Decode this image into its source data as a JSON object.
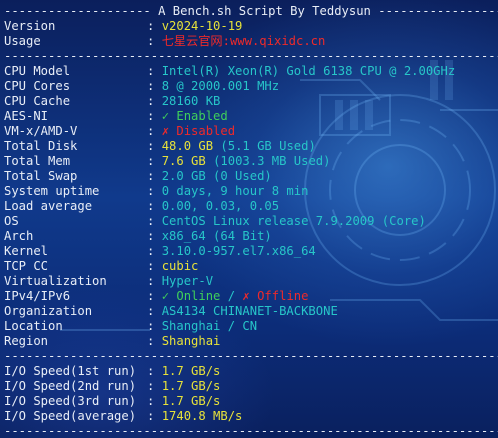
{
  "header_title": "A Bench.sh Script By Teddysun",
  "dash_left": "--------------------",
  "dash_right": "-------------------",
  "separator": "----------------------------------------------------------------------",
  "colon": ":",
  "meta": [
    {
      "label": "Version",
      "value": "v2024-10-19",
      "color": "yellow"
    },
    {
      "label": "Usage",
      "value": "七星云官网:www.qixidc.cn",
      "color": "red"
    }
  ],
  "system": [
    {
      "label": "CPU Model",
      "value": "Intel(R) Xeon(R) Gold 6138 CPU @ 2.00GHz",
      "color": "cyan"
    },
    {
      "label": "CPU Cores",
      "value": "8 @ 2000.001 MHz",
      "color": "cyan"
    },
    {
      "label": "CPU Cache",
      "value": "28160 KB",
      "color": "cyan"
    },
    {
      "label": "AES-NI",
      "value": "✓ Enabled",
      "color": "green"
    },
    {
      "label": "VM-x/AMD-V",
      "value": "✗ Disabled",
      "color": "red"
    },
    {
      "label": "Total Disk",
      "value": "48.0 GB",
      "color": "yellow",
      "extra": "(5.1 GB Used)"
    },
    {
      "label": "Total Mem",
      "value": "7.6 GB",
      "color": "yellow",
      "extra": "(1003.3 MB Used)"
    },
    {
      "label": "Total Swap",
      "value": "2.0 GB (0 Used)",
      "color": "cyan"
    },
    {
      "label": "System uptime",
      "value": "0 days, 9 hour 8 min",
      "color": "cyan"
    },
    {
      "label": "Load average",
      "value": "0.00, 0.03, 0.05",
      "color": "cyan"
    },
    {
      "label": "OS",
      "value": "CentOS Linux release 7.9.2009 (Core)",
      "color": "cyan"
    },
    {
      "label": "Arch",
      "value": "x86_64 (64 Bit)",
      "color": "cyan"
    },
    {
      "label": "Kernel",
      "value": "3.10.0-957.el7.x86_64",
      "color": "cyan"
    },
    {
      "label": "TCP CC",
      "value": "cubic",
      "color": "yellow"
    },
    {
      "label": "Virtualization",
      "value": "Hyper-V",
      "color": "cyan"
    },
    {
      "label": "IPv4/IPv6",
      "value": "✓ Online",
      "color": "green",
      "sep": "/",
      "value2": "✗ Offline",
      "color2": "red"
    },
    {
      "label": "Organization",
      "value": "AS4134 CHINANET-BACKBONE",
      "color": "cyan"
    },
    {
      "label": "Location",
      "value": "Shanghai / CN",
      "color": "cyan"
    },
    {
      "label": "Region",
      "value": "Shanghai",
      "color": "yellow"
    }
  ],
  "io": [
    {
      "label": "I/O Speed(1st run)",
      "value": "1.7 GB/s",
      "color": "yellow"
    },
    {
      "label": "I/O Speed(2nd run)",
      "value": "1.7 GB/s",
      "color": "yellow"
    },
    {
      "label": "I/O Speed(3rd run)",
      "value": "1.7 GB/s",
      "color": "yellow"
    },
    {
      "label": "I/O Speed(average)",
      "value": "1740.8 MB/s",
      "color": "yellow"
    }
  ],
  "colors": {
    "cyan": "#27c6c9",
    "yellow": "#e7e23a",
    "green": "#3fcf5a",
    "red": "#ee2a2a",
    "text": "#e9eef7",
    "background": "#0b1f5c"
  }
}
